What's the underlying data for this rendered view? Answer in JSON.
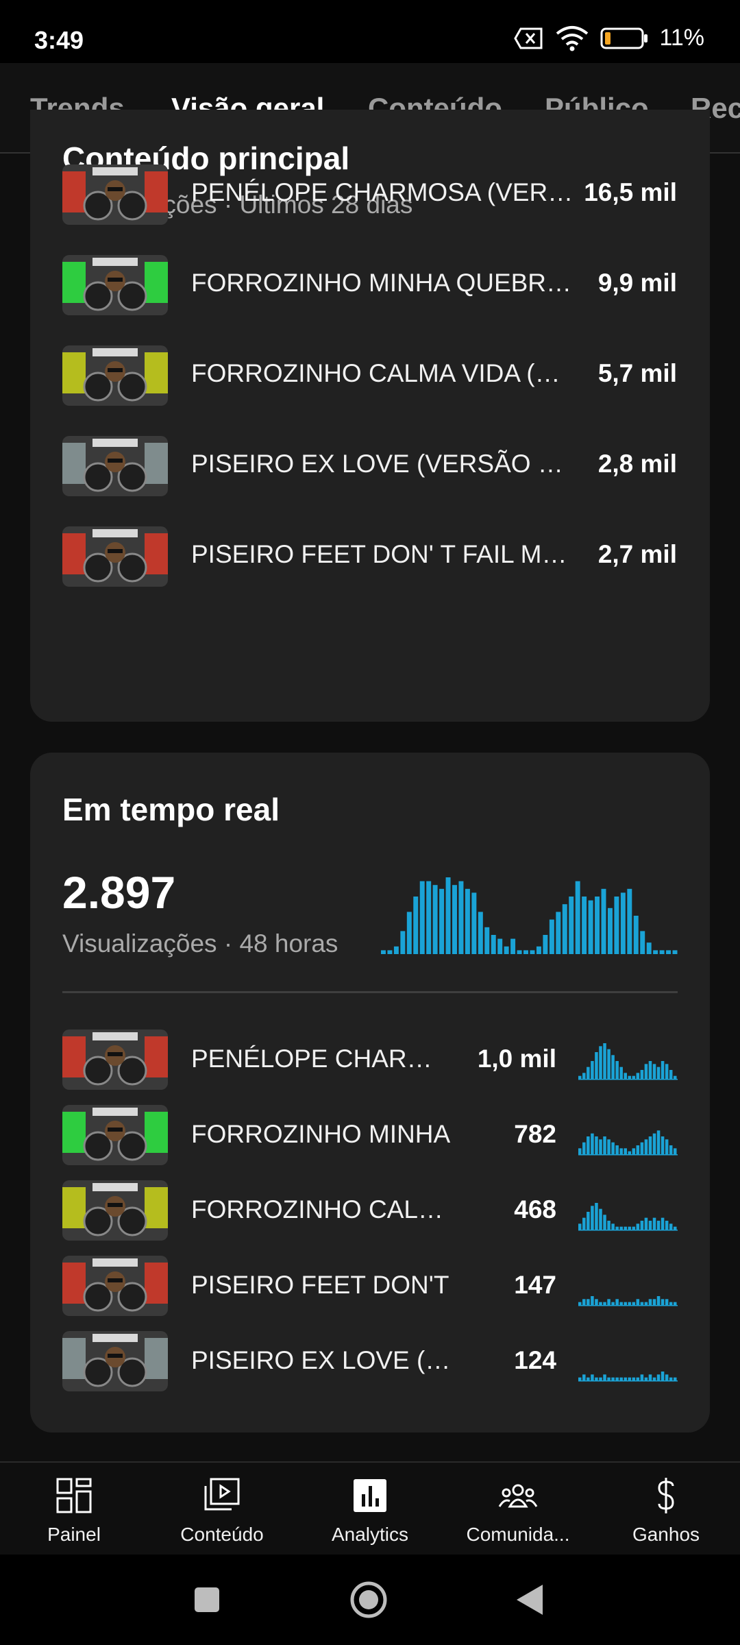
{
  "status": {
    "time": "3:49",
    "battery": "11%"
  },
  "tabs": [
    "Trends",
    "Visão geral",
    "Conteúdo",
    "Público",
    "Rec"
  ],
  "top_content": {
    "title": "Conteúdo principal",
    "subtitle": "Visualizações · Últimos 28 dias",
    "rows": [
      {
        "title": "PENÉLOPE CHARMOSA (VERSÃO",
        "value": "16,5 mil",
        "accent": "#c0392b"
      },
      {
        "title": "FORROZINHO MINHA QUEBRADA",
        "value": "9,9 mil",
        "accent": "#2ecc40"
      },
      {
        "title": "FORROZINHO CALMA VIDA (REMIX)",
        "value": "5,7 mil",
        "accent": "#b5bd1e"
      },
      {
        "title": "PISEIRO EX LOVE (VERSÃO BIU",
        "value": "2,8 mil",
        "accent": "#7f8c8d"
      },
      {
        "title": "PISEIRO FEET DON' T FAIL ME NOW",
        "value": "2,7 mil",
        "accent": "#c0392b"
      }
    ]
  },
  "realtime": {
    "title": "Em tempo real",
    "total": "2.897",
    "subtitle": "Visualizações · 48 horas",
    "bars": [
      1,
      1,
      2,
      6,
      11,
      15,
      19,
      19,
      18,
      17,
      20,
      18,
      19,
      17,
      16,
      11,
      7,
      5,
      4,
      2,
      4,
      1,
      1,
      1,
      2,
      5,
      9,
      11,
      13,
      15,
      19,
      15,
      14,
      15,
      17,
      12,
      15,
      16,
      17,
      10,
      6,
      3,
      1,
      1,
      1,
      1
    ],
    "rows": [
      {
        "title": "PENÉLOPE CHARMOSA",
        "value": "1,0 mil",
        "accent": "#c0392b",
        "spark": [
          1,
          2,
          4,
          6,
          9,
          11,
          12,
          10,
          8,
          6,
          4,
          2,
          1,
          1,
          2,
          3,
          5,
          6,
          5,
          4,
          6,
          5,
          3,
          1
        ]
      },
      {
        "title": "FORROZINHO MINHA",
        "value": "782",
        "accent": "#2ecc40",
        "spark": [
          2,
          4,
          6,
          7,
          6,
          5,
          6,
          5,
          4,
          3,
          2,
          2,
          1,
          2,
          3,
          4,
          5,
          6,
          7,
          8,
          6,
          5,
          3,
          2
        ]
      },
      {
        "title": "FORROZINHO CALMA",
        "value": "468",
        "accent": "#b5bd1e",
        "spark": [
          2,
          4,
          6,
          8,
          9,
          7,
          5,
          3,
          2,
          1,
          1,
          1,
          1,
          1,
          2,
          3,
          4,
          3,
          4,
          3,
          4,
          3,
          2,
          1
        ]
      },
      {
        "title": "PISEIRO FEET DON'T",
        "value": "147",
        "accent": "#c0392b",
        "spark": [
          1,
          2,
          2,
          3,
          2,
          1,
          1,
          2,
          1,
          2,
          1,
          1,
          1,
          1,
          2,
          1,
          1,
          2,
          2,
          3,
          2,
          2,
          1,
          1
        ]
      },
      {
        "title": "PISEIRO EX LOVE (VERSÃO",
        "value": "124",
        "accent": "#7f8c8d",
        "spark": [
          1,
          2,
          1,
          2,
          1,
          1,
          2,
          1,
          1,
          1,
          1,
          1,
          1,
          1,
          1,
          2,
          1,
          2,
          1,
          2,
          3,
          2,
          1,
          1
        ]
      }
    ]
  },
  "nav": [
    {
      "label": "Painel",
      "icon": "dashboard-icon"
    },
    {
      "label": "Conteúdo",
      "icon": "content-icon"
    },
    {
      "label": "Analytics",
      "icon": "analytics-icon"
    },
    {
      "label": "Comunida...",
      "icon": "community-icon"
    },
    {
      "label": "Ganhos",
      "icon": "dollar-icon"
    }
  ],
  "colors": {
    "accent": "#1aa3d6",
    "card": "#212121",
    "background": "#0f0f0f"
  }
}
